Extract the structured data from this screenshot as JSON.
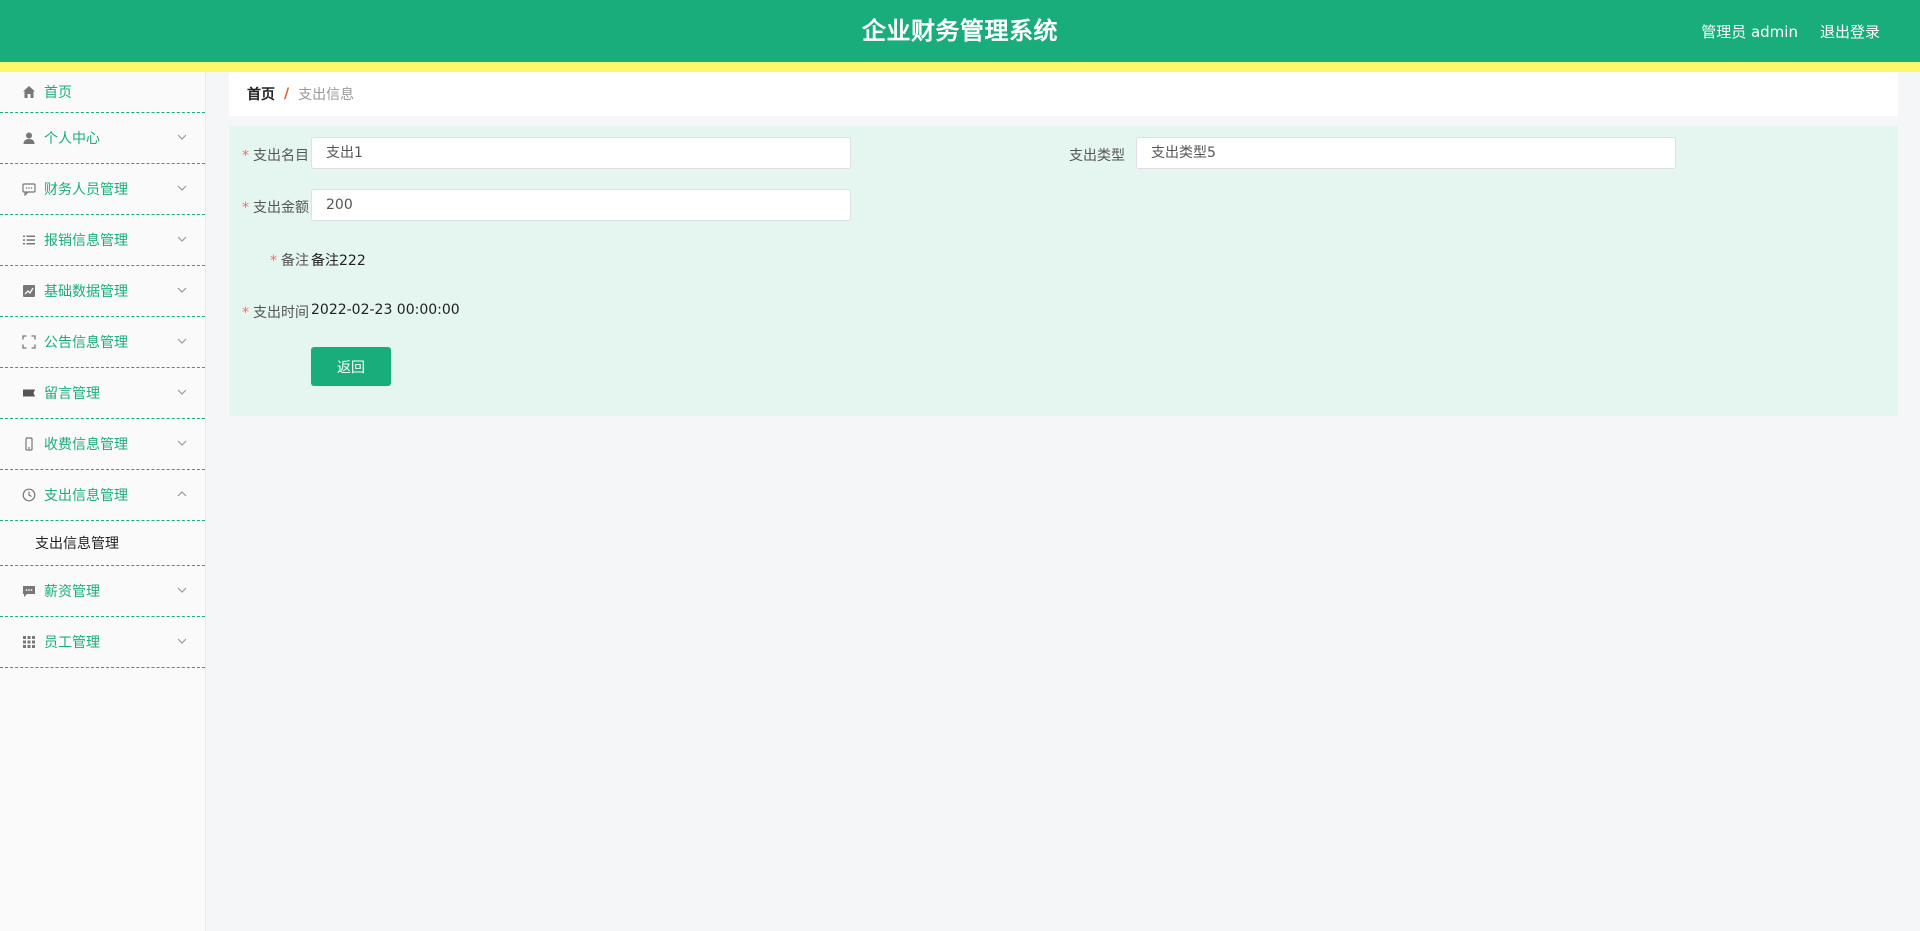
{
  "header": {
    "title": "企业财务管理系统",
    "user": "管理员 admin",
    "logout": "退出登录",
    "colors": {
      "primary": "#1aad7c",
      "stripe": "#fbf96b"
    }
  },
  "sidebar": {
    "items": [
      {
        "label": "首页",
        "icon": "home-icon"
      },
      {
        "label": "个人中心",
        "icon": "user-icon"
      },
      {
        "label": "财务人员管理",
        "icon": "chat-icon"
      },
      {
        "label": "报销信息管理",
        "icon": "list-icon"
      },
      {
        "label": "基础数据管理",
        "icon": "chart-icon"
      },
      {
        "label": "公告信息管理",
        "icon": "fullscreen-icon"
      },
      {
        "label": "留言管理",
        "icon": "ticket-icon"
      },
      {
        "label": "收费信息管理",
        "icon": "mobile-icon"
      },
      {
        "label": "支出信息管理",
        "icon": "clock-icon",
        "expanded": true
      },
      {
        "label": "薪资管理",
        "icon": "message-icon"
      },
      {
        "label": "员工管理",
        "icon": "grid-icon"
      }
    ],
    "submenu": {
      "label": "支出信息管理"
    }
  },
  "breadcrumb": {
    "home": "首页",
    "separator": "/",
    "current": "支出信息"
  },
  "form": {
    "name": {
      "label": "支出名目",
      "value": "支出1",
      "required": true
    },
    "type": {
      "label": "支出类型",
      "value": "支出类型5",
      "required": false
    },
    "amount": {
      "label": "支出金额",
      "value": "200",
      "required": true
    },
    "remark": {
      "label": "备注",
      "value": "备注222",
      "required": true
    },
    "time": {
      "label": "支出时间",
      "value": "2022-02-23 00:00:00",
      "required": true
    },
    "back_label": "返回"
  }
}
